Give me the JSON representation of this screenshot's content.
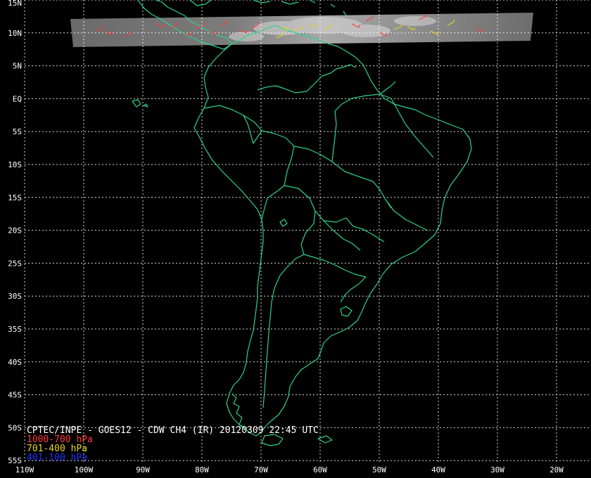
{
  "title": "CPTEC/INPE - GOES12 - CDW CH4 (IR) 20120309 22:45 UTC",
  "legend": [
    {
      "label": "1000-700 hPa",
      "color": "#ff3b3b"
    },
    {
      "label": "701-400 hPa",
      "color": "#e6d21e"
    },
    {
      "label": "401-100 hPa",
      "color": "#2233ff"
    }
  ],
  "lat_labels": [
    "15N",
    "10N",
    "5N",
    "EQ",
    "5S",
    "10S",
    "15S",
    "20S",
    "25S",
    "30S",
    "35S",
    "40S",
    "45S",
    "50S",
    "55S"
  ],
  "lon_labels": [
    "110W",
    "100W",
    "90W",
    "80W",
    "70W",
    "60W",
    "50W",
    "40W",
    "30W",
    "20W"
  ],
  "colors": {
    "background": "#000000",
    "coastline": "#2fd08f",
    "grid": "#ffffff"
  }
}
